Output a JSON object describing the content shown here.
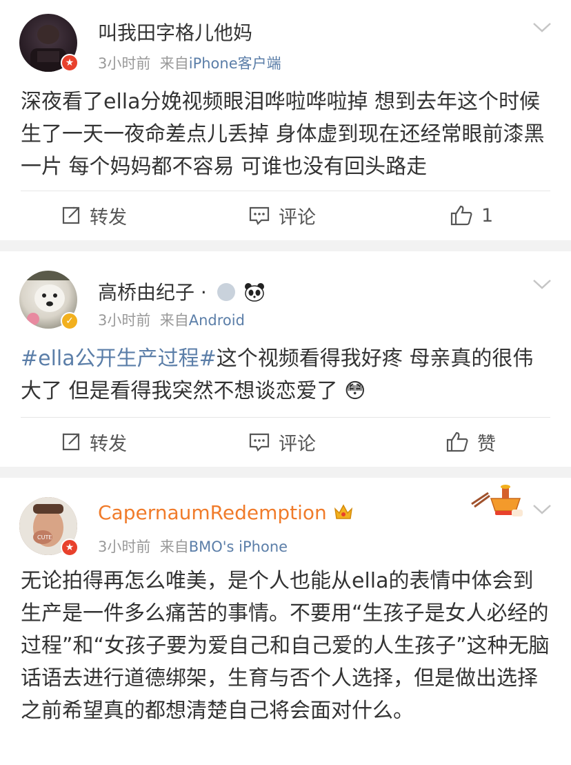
{
  "posts": [
    {
      "username": "叫我田字格儿他妈",
      "time": "3小时前",
      "from_label": "来自",
      "source": "iPhone客户端",
      "content": "深夜看了ella分娩视频眼泪哗啦哗啦掉 想到去年这个时候生了一天一夜命差点儿丢掉 身体虚到现在还经常眼前漆黑一片 每个妈妈都不容易 可谁也没有回头路走",
      "actions": {
        "repost": "转发",
        "comment": "评论",
        "like": "1"
      }
    },
    {
      "username": "高桥由纪子 ·",
      "time": "3小时前",
      "from_label": "来自",
      "source": "Android",
      "hashtag": "#ella公开生产过程#",
      "content": "这个视频看得我好疼 母亲真的很伟大了 但是看得我突然不想谈恋爱了",
      "emoji": "😳",
      "actions": {
        "repost": "转发",
        "comment": "评论",
        "like": "赞"
      }
    },
    {
      "username": "CapernaumRedemption",
      "time": "3小时前",
      "from_label": "来自",
      "source": "BMO's iPhone",
      "content": "无论拍得再怎么唯美，是个人也能从ella的表情中体会到生产是一件多么痛苦的事情。不要用“生孩子是女人必经的过程”和“女孩子要为爱自己和自己爱的人生孩子”这种无脑话语去进行道德绑架，生育与否个人选择，但是做出选择之前希望真的都想清楚自己将会面对什么。"
    }
  ],
  "colors": {
    "link": "#5b7ea8",
    "vip_name": "#f07b2a",
    "badge_red": "#e8412c",
    "badge_gold": "#f2b01e"
  },
  "icons": [
    "chevron-down-icon",
    "repost-icon",
    "comment-icon",
    "like-icon",
    "verified-badge-icon",
    "crown-icon",
    "panda-icon",
    "medal-icon"
  ]
}
